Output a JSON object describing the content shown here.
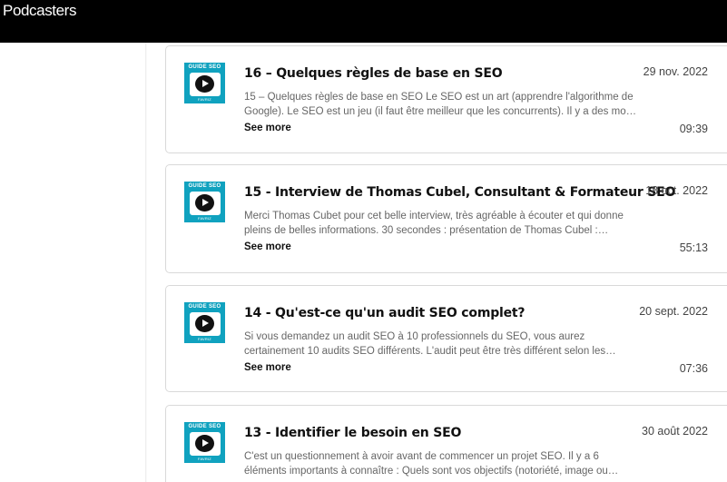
{
  "header": {
    "brand": "Podcasters"
  },
  "episodes": [
    {
      "title": "16 – Quelques règles de base en SEO",
      "date": "29 nov. 2022",
      "description": "15 – Quelques règles de base en SEO Le SEO est un art (apprendre l'algorithme de Google). Le SEO est un jeu (il faut être meilleur que les concurrents). Il y a des mo…",
      "see_more": "See more",
      "duration": "09:39",
      "thumb_icon": "play-icon"
    },
    {
      "title": "15 - Interview de Thomas Cubel, Consultant & Formateur SEO",
      "date": "18 oct. 2022",
      "description": "Merci Thomas Cubet pour cet belle interview, très agréable à écouter et qui donne pleins de belles informations. 30 secondes : présentation de Thomas Cubel :…",
      "see_more": "See more",
      "duration": "55:13",
      "thumb_icon": "play-icon"
    },
    {
      "title": "14 - Qu'est-ce qu'un audit SEO complet?",
      "date": "20 sept. 2022",
      "description": "Si vous demandez un audit SEO à 10 professionnels du SEO, vous aurez certainement 10 audits SEO différents. L'audit peut être très différent selon les…",
      "see_more": "See more",
      "duration": "07:36",
      "thumb_icon": "play-icon"
    },
    {
      "title": "13 - Identifier le besoin en SEO",
      "date": "30 août 2022",
      "description": "C'est un questionnement à avoir avant de commencer un projet SEO. Il y a 6 éléments importants à connaître : Quels sont vos objectifs (notoriété, image ou…",
      "see_more": "See more",
      "duration": "",
      "thumb_icon": "play-icon"
    }
  ],
  "thumbnail": {
    "label": "GUIDE SEO",
    "footer": "FAVRIZ",
    "color": "#10a2bf"
  }
}
